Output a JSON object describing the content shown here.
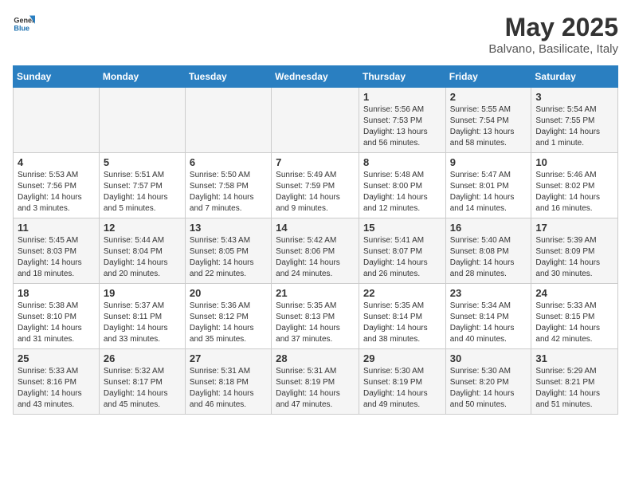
{
  "header": {
    "logo_general": "General",
    "logo_blue": "Blue",
    "title": "May 2025",
    "subtitle": "Balvano, Basilicate, Italy"
  },
  "weekdays": [
    "Sunday",
    "Monday",
    "Tuesday",
    "Wednesday",
    "Thursday",
    "Friday",
    "Saturday"
  ],
  "weeks": [
    [
      {
        "day": "",
        "info": ""
      },
      {
        "day": "",
        "info": ""
      },
      {
        "day": "",
        "info": ""
      },
      {
        "day": "",
        "info": ""
      },
      {
        "day": "1",
        "info": "Sunrise: 5:56 AM\nSunset: 7:53 PM\nDaylight: 13 hours and 56 minutes."
      },
      {
        "day": "2",
        "info": "Sunrise: 5:55 AM\nSunset: 7:54 PM\nDaylight: 13 hours and 58 minutes."
      },
      {
        "day": "3",
        "info": "Sunrise: 5:54 AM\nSunset: 7:55 PM\nDaylight: 14 hours and 1 minute."
      }
    ],
    [
      {
        "day": "4",
        "info": "Sunrise: 5:53 AM\nSunset: 7:56 PM\nDaylight: 14 hours and 3 minutes."
      },
      {
        "day": "5",
        "info": "Sunrise: 5:51 AM\nSunset: 7:57 PM\nDaylight: 14 hours and 5 minutes."
      },
      {
        "day": "6",
        "info": "Sunrise: 5:50 AM\nSunset: 7:58 PM\nDaylight: 14 hours and 7 minutes."
      },
      {
        "day": "7",
        "info": "Sunrise: 5:49 AM\nSunset: 7:59 PM\nDaylight: 14 hours and 9 minutes."
      },
      {
        "day": "8",
        "info": "Sunrise: 5:48 AM\nSunset: 8:00 PM\nDaylight: 14 hours and 12 minutes."
      },
      {
        "day": "9",
        "info": "Sunrise: 5:47 AM\nSunset: 8:01 PM\nDaylight: 14 hours and 14 minutes."
      },
      {
        "day": "10",
        "info": "Sunrise: 5:46 AM\nSunset: 8:02 PM\nDaylight: 14 hours and 16 minutes."
      }
    ],
    [
      {
        "day": "11",
        "info": "Sunrise: 5:45 AM\nSunset: 8:03 PM\nDaylight: 14 hours and 18 minutes."
      },
      {
        "day": "12",
        "info": "Sunrise: 5:44 AM\nSunset: 8:04 PM\nDaylight: 14 hours and 20 minutes."
      },
      {
        "day": "13",
        "info": "Sunrise: 5:43 AM\nSunset: 8:05 PM\nDaylight: 14 hours and 22 minutes."
      },
      {
        "day": "14",
        "info": "Sunrise: 5:42 AM\nSunset: 8:06 PM\nDaylight: 14 hours and 24 minutes."
      },
      {
        "day": "15",
        "info": "Sunrise: 5:41 AM\nSunset: 8:07 PM\nDaylight: 14 hours and 26 minutes."
      },
      {
        "day": "16",
        "info": "Sunrise: 5:40 AM\nSunset: 8:08 PM\nDaylight: 14 hours and 28 minutes."
      },
      {
        "day": "17",
        "info": "Sunrise: 5:39 AM\nSunset: 8:09 PM\nDaylight: 14 hours and 30 minutes."
      }
    ],
    [
      {
        "day": "18",
        "info": "Sunrise: 5:38 AM\nSunset: 8:10 PM\nDaylight: 14 hours and 31 minutes."
      },
      {
        "day": "19",
        "info": "Sunrise: 5:37 AM\nSunset: 8:11 PM\nDaylight: 14 hours and 33 minutes."
      },
      {
        "day": "20",
        "info": "Sunrise: 5:36 AM\nSunset: 8:12 PM\nDaylight: 14 hours and 35 minutes."
      },
      {
        "day": "21",
        "info": "Sunrise: 5:35 AM\nSunset: 8:13 PM\nDaylight: 14 hours and 37 minutes."
      },
      {
        "day": "22",
        "info": "Sunrise: 5:35 AM\nSunset: 8:14 PM\nDaylight: 14 hours and 38 minutes."
      },
      {
        "day": "23",
        "info": "Sunrise: 5:34 AM\nSunset: 8:14 PM\nDaylight: 14 hours and 40 minutes."
      },
      {
        "day": "24",
        "info": "Sunrise: 5:33 AM\nSunset: 8:15 PM\nDaylight: 14 hours and 42 minutes."
      }
    ],
    [
      {
        "day": "25",
        "info": "Sunrise: 5:33 AM\nSunset: 8:16 PM\nDaylight: 14 hours and 43 minutes."
      },
      {
        "day": "26",
        "info": "Sunrise: 5:32 AM\nSunset: 8:17 PM\nDaylight: 14 hours and 45 minutes."
      },
      {
        "day": "27",
        "info": "Sunrise: 5:31 AM\nSunset: 8:18 PM\nDaylight: 14 hours and 46 minutes."
      },
      {
        "day": "28",
        "info": "Sunrise: 5:31 AM\nSunset: 8:19 PM\nDaylight: 14 hours and 47 minutes."
      },
      {
        "day": "29",
        "info": "Sunrise: 5:30 AM\nSunset: 8:19 PM\nDaylight: 14 hours and 49 minutes."
      },
      {
        "day": "30",
        "info": "Sunrise: 5:30 AM\nSunset: 8:20 PM\nDaylight: 14 hours and 50 minutes."
      },
      {
        "day": "31",
        "info": "Sunrise: 5:29 AM\nSunset: 8:21 PM\nDaylight: 14 hours and 51 minutes."
      }
    ]
  ]
}
